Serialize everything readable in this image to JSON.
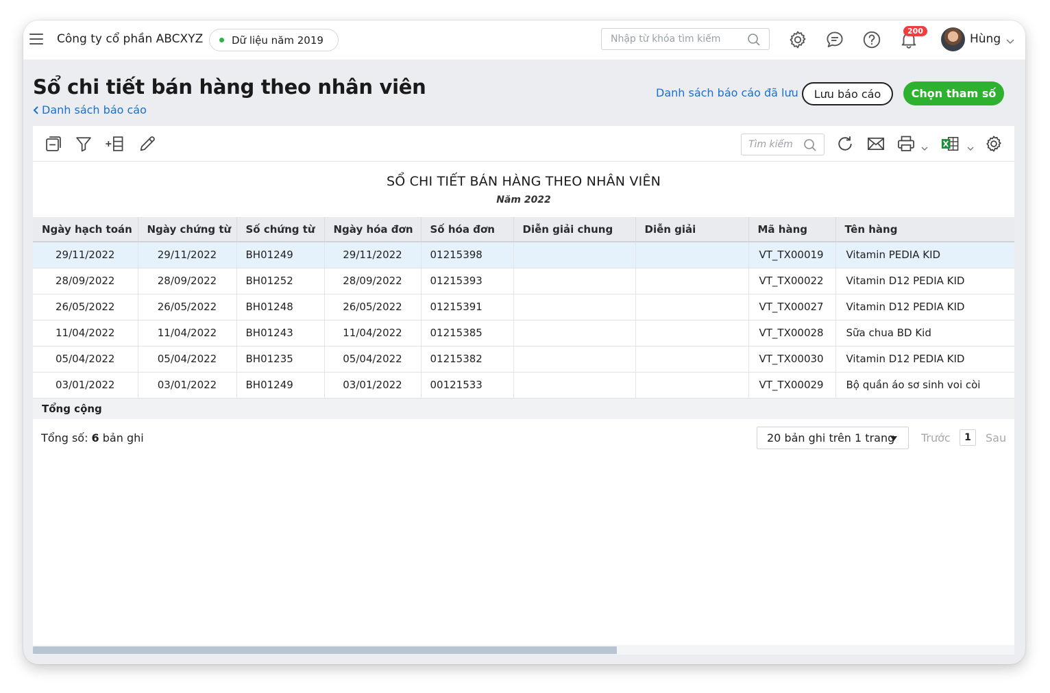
{
  "topbar": {
    "company": "Công ty cổ phần ABCXYZ",
    "data_year": "Dữ liệu năm 2019",
    "search_placeholder": "Nhập từ khóa tìm kiếm",
    "notification_count": "200",
    "user_name": "Hùng"
  },
  "header": {
    "title": "Sổ chi tiết bán hàng theo nhân viên",
    "back_link": "Danh sách báo cáo",
    "saved_reports_link": "Danh sách báo cáo đã lưu",
    "save_button": "Lưu báo cáo",
    "params_button": "Chọn tham số"
  },
  "toolbar": {
    "search_placeholder": "Tìm kiếm"
  },
  "report": {
    "title": "SỔ CHI TIẾT BÁN HÀNG THEO NHÂN VIÊN",
    "subtitle": "Năm 2022",
    "columns": [
      "Ngày hạch toán",
      "Ngày chứng từ",
      "Số chứng từ",
      "Ngày hóa đơn",
      "Số hóa đơn",
      "Diễn giải chung",
      "Diễn giải",
      "Mã hàng",
      "Tên hàng"
    ],
    "rows": [
      [
        "29/11/2022",
        "29/11/2022",
        "BH01249",
        "29/11/2022",
        "01215398",
        "",
        "",
        "VT_TX00019",
        "Vitamin PEDIA KID"
      ],
      [
        "28/09/2022",
        "28/09/2022",
        "BH01252",
        "28/09/2022",
        "01215393",
        "",
        "",
        "VT_TX00022",
        "Vitamin D12 PEDIA KID"
      ],
      [
        "26/05/2022",
        "26/05/2022",
        "BH01248",
        "26/05/2022",
        "01215391",
        "",
        "",
        "VT_TX00027",
        "Vitamin D12 PEDIA KID"
      ],
      [
        "11/04/2022",
        "11/04/2022",
        "BH01243",
        "11/04/2022",
        "01215385",
        "",
        "",
        "VT_TX00028",
        "Sữa chua BD Kid"
      ],
      [
        "05/04/2022",
        "05/04/2022",
        "BH01235",
        "05/04/2022",
        "01215382",
        "",
        "",
        "VT_TX00030",
        "Vitamin D12 PEDIA KID"
      ],
      [
        "03/01/2022",
        "03/01/2022",
        "BH01249",
        "03/01/2022",
        "00121533",
        "",
        "",
        "VT_TX00029",
        "Bộ quần áo sơ sinh voi còi"
      ]
    ],
    "selected_row": 0,
    "footer_label": "Tổng cộng"
  },
  "pagination": {
    "total_label": "Tổng số: ",
    "total_count": "6",
    "total_suffix": " bản ghi",
    "page_size": "20 bản ghi trên 1 trang",
    "prev": "Trước",
    "current_page": "1",
    "next": "Sau"
  },
  "colors": {
    "accent_green": "#2db12f",
    "link_blue": "#1a6fcf",
    "badge_red": "#f03d3d",
    "selected_row": "#e5f1fb"
  }
}
